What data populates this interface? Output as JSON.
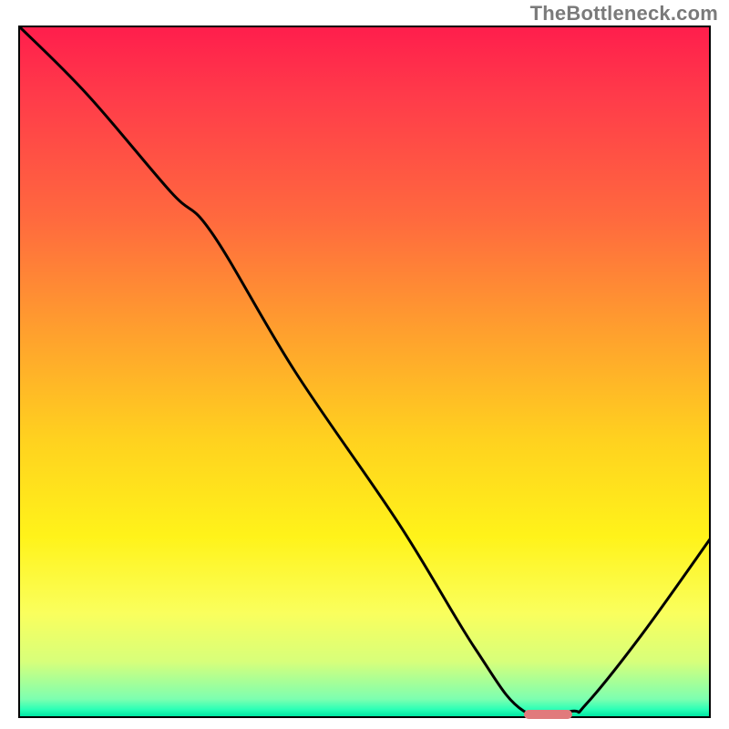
{
  "watermark": "TheBottleneck.com",
  "chart_data": {
    "type": "line",
    "title": "",
    "xlabel": "",
    "ylabel": "",
    "xlim": [
      0,
      100
    ],
    "ylim": [
      0,
      100
    ],
    "grid": false,
    "legend": false,
    "background_gradient": {
      "stops": [
        {
          "pos": 0.0,
          "color": "#ff1e4c"
        },
        {
          "pos": 0.28,
          "color": "#ff6a3e"
        },
        {
          "pos": 0.6,
          "color": "#ffd21f"
        },
        {
          "pos": 0.85,
          "color": "#faff5d"
        },
        {
          "pos": 0.975,
          "color": "#7dffb0"
        },
        {
          "pos": 1.0,
          "color": "#00e7a3"
        }
      ]
    },
    "series": [
      {
        "name": "bottleneck-curve",
        "x": [
          0,
          10,
          22,
          28,
          40,
          55,
          66,
          73,
          80,
          82,
          90,
          100
        ],
        "y": [
          100,
          90,
          76,
          70,
          50,
          28,
          10,
          1,
          1,
          2,
          12,
          26
        ]
      }
    ],
    "marker": {
      "name": "optimal-range",
      "x_center": 76.5,
      "y": 0.5,
      "width": 7,
      "height": 1.3,
      "color": "#e17a7c"
    }
  }
}
